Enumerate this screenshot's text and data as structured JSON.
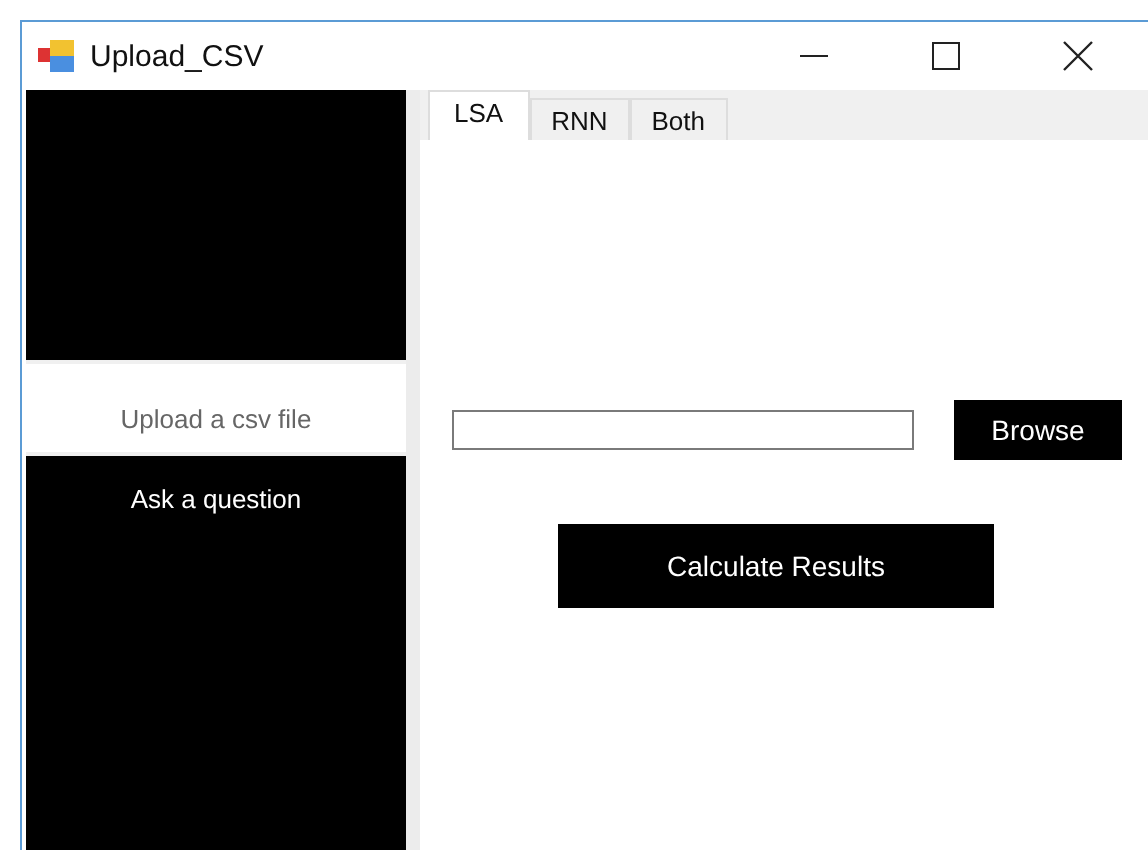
{
  "window": {
    "title": "Upload_CSV"
  },
  "sidebar": {
    "items": [
      {
        "label": "Upload a csv file",
        "selected": true
      },
      {
        "label": "Ask a question",
        "selected": false
      }
    ]
  },
  "tabs": [
    {
      "label": "LSA",
      "selected": true
    },
    {
      "label": "RNN",
      "selected": false
    },
    {
      "label": "Both",
      "selected": false
    }
  ],
  "browse_button": "Browse",
  "calculate_button": "Calculate Results"
}
